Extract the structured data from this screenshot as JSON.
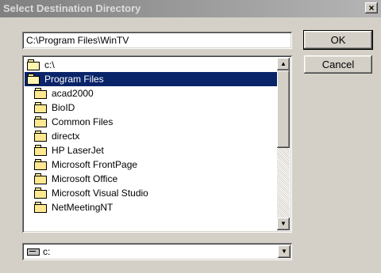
{
  "window": {
    "title": "Select Destination Directory",
    "close_glyph": "×"
  },
  "path_input": {
    "value": "C:\\Program Files\\WinTV"
  },
  "buttons": {
    "ok": "OK",
    "cancel": "Cancel"
  },
  "folders": [
    {
      "label": "c:\\",
      "icon": "open-folder-icon",
      "level": 0,
      "selected": false
    },
    {
      "label": "Program Files",
      "icon": "open-folder-icon",
      "level": 0,
      "selected": true
    },
    {
      "label": "acad2000",
      "icon": "folder-icon",
      "level": 1,
      "selected": false
    },
    {
      "label": "BioID",
      "icon": "folder-icon",
      "level": 1,
      "selected": false
    },
    {
      "label": "Common Files",
      "icon": "folder-icon",
      "level": 1,
      "selected": false
    },
    {
      "label": "directx",
      "icon": "folder-icon",
      "level": 1,
      "selected": false
    },
    {
      "label": "HP LaserJet",
      "icon": "folder-icon",
      "level": 1,
      "selected": false
    },
    {
      "label": "Microsoft FrontPage",
      "icon": "folder-icon",
      "level": 1,
      "selected": false
    },
    {
      "label": "Microsoft Office",
      "icon": "folder-icon",
      "level": 1,
      "selected": false
    },
    {
      "label": "Microsoft Visual Studio",
      "icon": "folder-icon",
      "level": 1,
      "selected": false
    },
    {
      "label": "NetMeetingNT",
      "icon": "folder-icon",
      "level": 1,
      "selected": false
    }
  ],
  "scrollbar": {
    "up_glyph": "▲",
    "down_glyph": "▼"
  },
  "drive_select": {
    "value": "c:",
    "icon": "drive-icon",
    "arrow_glyph": "▼"
  },
  "colors": {
    "selection": "#0a246a",
    "face": "#d4d0c8"
  }
}
